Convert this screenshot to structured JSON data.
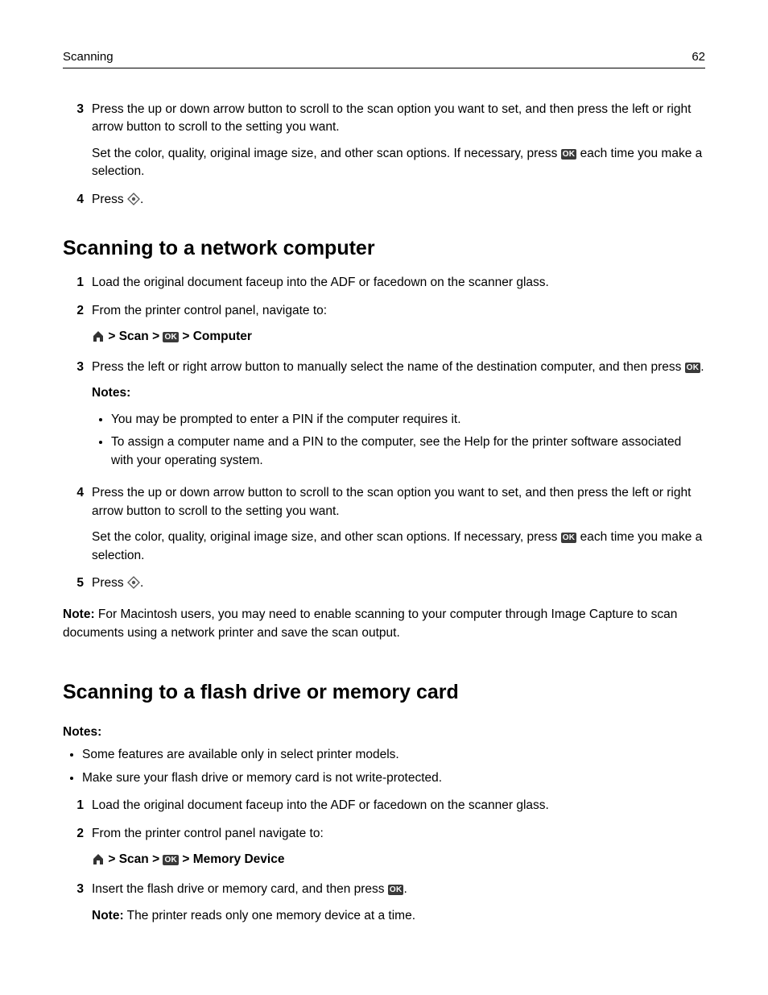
{
  "header": {
    "section": "Scanning",
    "page": "62"
  },
  "pre_steps": {
    "s3": {
      "num": "3",
      "p1": "Press the up or down arrow button to scroll to the scan option you want to set, and then press the left or right arrow button to scroll to the setting you want.",
      "p2a": "Set the color, quality, original image size, and other scan options. If necessary, press ",
      "p2b": " each time you make a selection."
    },
    "s4": {
      "num": "4",
      "p1a": "Press ",
      "p1b": "."
    }
  },
  "h_network": "Scanning to a network computer",
  "net": {
    "s1": {
      "num": "1",
      "p1": "Load the original document faceup into the ADF or facedown on the scanner glass."
    },
    "s2": {
      "num": "2",
      "p1": "From the printer control panel, navigate to:",
      "path_scan": "Scan",
      "path_dest": "Computer",
      "gt": ">"
    },
    "s3": {
      "num": "3",
      "p1a": "Press the left or right arrow button to manually select the name of the destination computer, and then press ",
      "p1b": ".",
      "notes_label": "Notes:",
      "n1": "You may be prompted to enter a PIN if the computer requires it.",
      "n2": "To assign a computer name and a PIN to the computer, see the Help for the printer software associated with your operating system."
    },
    "s4": {
      "num": "4",
      "p1": "Press the up or down arrow button to scroll to the scan option you want to set, and then press the left or right arrow button to scroll to the setting you want.",
      "p2a": "Set the color, quality, original image size, and other scan options. If necessary, press ",
      "p2b": " each time you make a selection."
    },
    "s5": {
      "num": "5",
      "p1a": "Press ",
      "p1b": "."
    }
  },
  "net_note": {
    "label": "Note:",
    "text": " For Macintosh users, you may need to enable scanning to your computer through Image Capture to scan documents using a network printer and save the scan output."
  },
  "h_flash": "Scanning to a flash drive or memory card",
  "flash_notes": {
    "label": "Notes:",
    "n1": "Some features are available only in select printer models.",
    "n2": "Make sure your flash drive or memory card is not write-protected."
  },
  "flash": {
    "s1": {
      "num": "1",
      "p1": "Load the original document faceup into the ADF or facedown on the scanner glass."
    },
    "s2": {
      "num": "2",
      "p1": "From the printer control panel navigate to:",
      "path_scan": "Scan",
      "path_dest": "Memory Device",
      "gt": ">"
    },
    "s3": {
      "num": "3",
      "p1a": "Insert the flash drive or memory card, and then press ",
      "p1b": ".",
      "note_label": "Note:",
      "note_text": " The printer reads only one memory device at a time."
    }
  },
  "icons": {
    "ok_text": "OK"
  }
}
